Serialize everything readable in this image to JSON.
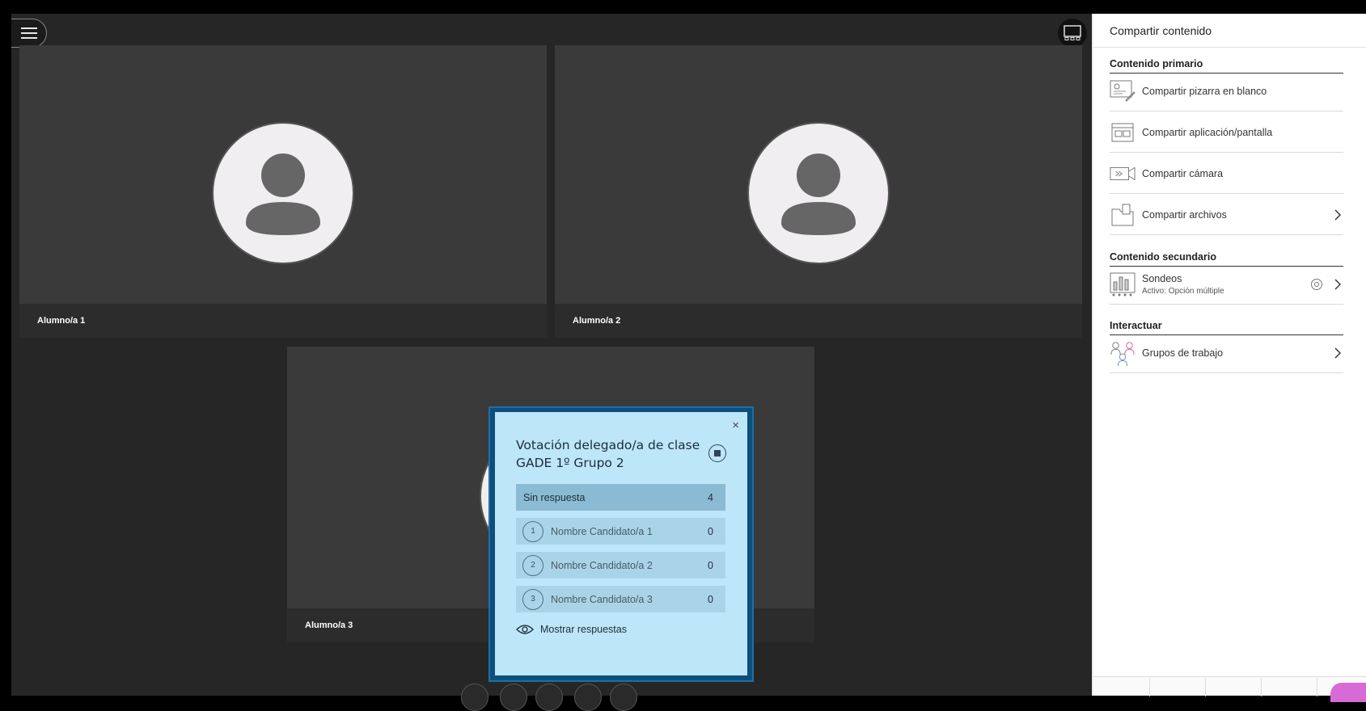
{
  "stage": {
    "participants": [
      {
        "name": "Alumno/a 1"
      },
      {
        "name": "Alumno/a 2"
      },
      {
        "name": "Alumno/a 3"
      }
    ]
  },
  "poll": {
    "title": "Votación delegado/a de clase GADE 1º Grupo 2",
    "close_label": "×",
    "no_response": {
      "label": "Sin respuesta",
      "count": "4"
    },
    "options": [
      {
        "num": "1",
        "label": "Nombre Candidato/a 1",
        "count": "0"
      },
      {
        "num": "2",
        "label": "Nombre Candidato/a 2",
        "count": "0"
      },
      {
        "num": "3",
        "label": "Nombre Candidato/a 3",
        "count": "0"
      }
    ],
    "show_responses": "Mostrar respuestas"
  },
  "panel": {
    "title": "Compartir contenido",
    "primary": {
      "title": "Contenido primario",
      "items": [
        {
          "label": "Compartir pizarra en blanco",
          "icon": "whiteboard-icon"
        },
        {
          "label": "Compartir aplicación/pantalla",
          "icon": "screen-share-icon"
        },
        {
          "label": "Compartir cámara",
          "icon": "camera-icon"
        },
        {
          "label": "Compartir archivos",
          "icon": "files-icon"
        }
      ]
    },
    "secondary": {
      "title": "Contenido secundario",
      "items": [
        {
          "label": "Sondeos",
          "sub": "Activo: Opción múltiple",
          "icon": "polling-icon"
        }
      ]
    },
    "interact": {
      "title": "Interactuar",
      "items": [
        {
          "label": "Grupos de trabajo",
          "icon": "breakout-groups-icon"
        }
      ]
    }
  },
  "colors": {
    "stage_bg": "#262626",
    "tile_bg": "#3a3a3a",
    "poll_bg": "#bde6f8",
    "poll_border": "#1f6fa3",
    "accent_pink": "#d76ad4"
  }
}
